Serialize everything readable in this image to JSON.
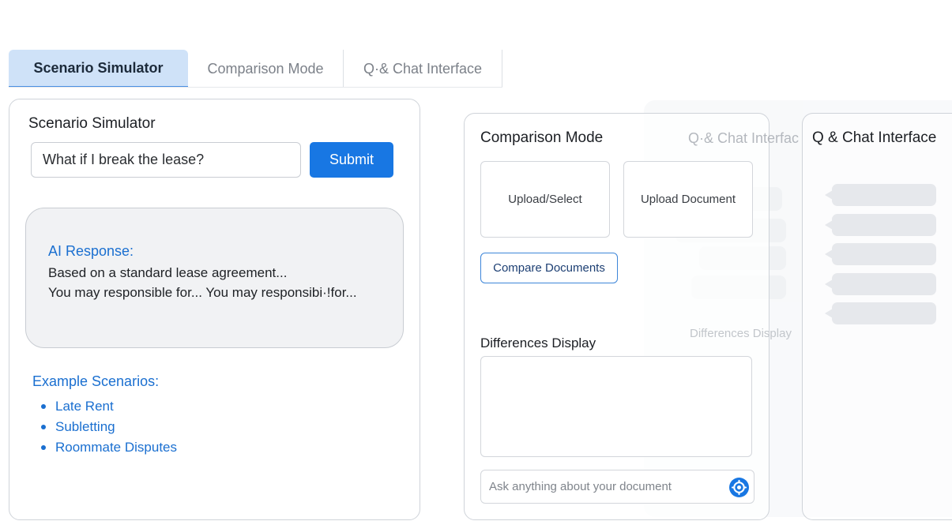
{
  "tabs": [
    {
      "label": "Scenario Simulator",
      "active": true
    },
    {
      "label": "Comparison Mode",
      "active": false
    },
    {
      "label": "Q·& Chat Interface",
      "active": false
    }
  ],
  "scenario": {
    "title": "Scenario Simulator",
    "query_value": "What if I break the lease?",
    "submit_label": "Submit",
    "ai_response": {
      "label": "AI Response:",
      "line1": "Based on a standard lease agreement...",
      "line2": "You may responsible for... You may responsibi·!for..."
    },
    "examples_title": "Example Scenarios:",
    "examples": [
      "Late Rent",
      "Subletting",
      "Roommate Disputes"
    ]
  },
  "comparison": {
    "title": "Comparison Mode",
    "ghost_title": "Q·& Chat Interfac",
    "upload_select_label": "Upload/Select",
    "upload_document_label": "Upload Document",
    "compare_button_label": "Compare Documents",
    "ghost_differences_label": "Differences Display",
    "differences_title": "Differences Display",
    "ask_placeholder": "Ask anything about your document"
  },
  "chat": {
    "title": "Q & Chat Interface",
    "message_count": 5
  },
  "colors": {
    "accent": "#1877e3",
    "link_blue": "#1a6fd0",
    "active_tab_bg": "#cfe2f8"
  },
  "icons": {
    "ask_submit": "settings-circle-icon"
  }
}
